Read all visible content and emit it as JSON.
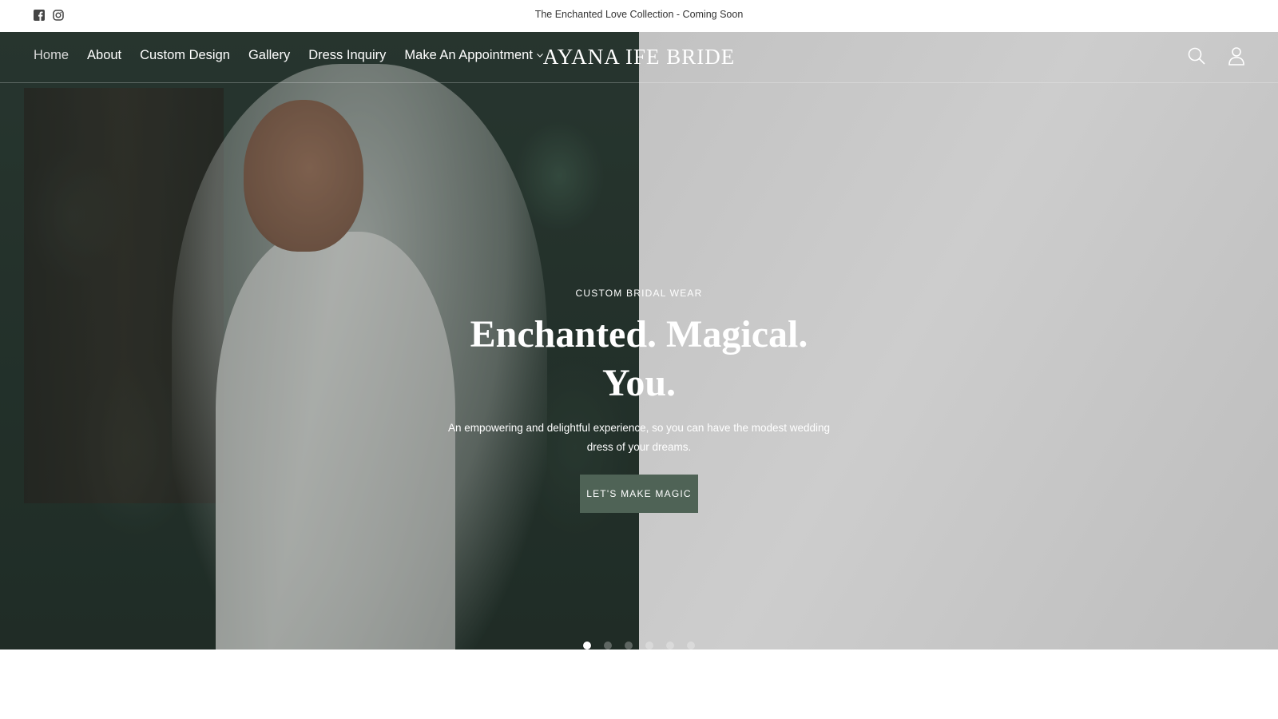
{
  "announcement": {
    "text": "The Enchanted Love Collection - Coming Soon",
    "social": [
      "facebook-icon",
      "instagram-icon"
    ]
  },
  "nav": {
    "items": [
      {
        "label": "Home",
        "active": true
      },
      {
        "label": "About"
      },
      {
        "label": "Custom Design"
      },
      {
        "label": "Gallery"
      },
      {
        "label": "Dress Inquiry"
      },
      {
        "label": "Make An Appointment",
        "has_dropdown": true
      }
    ],
    "logo": "AYANA IFE BRIDE",
    "icons": [
      "search-icon",
      "account-icon"
    ]
  },
  "hero": {
    "eyebrow": "CUSTOM BRIDAL WEAR",
    "headline": "Enchanted. Magical. You.",
    "subtext": "An empowering and delightful experience, so you can have the modest wedding dress of your dreams.",
    "cta": "LET'S MAKE MAGIC",
    "slides_total": 6,
    "active_slide": 1
  },
  "colors": {
    "cta_background": "#4f6356",
    "overlay_gray": "#c4c4c4",
    "text_on_hero": "#ffffff"
  }
}
